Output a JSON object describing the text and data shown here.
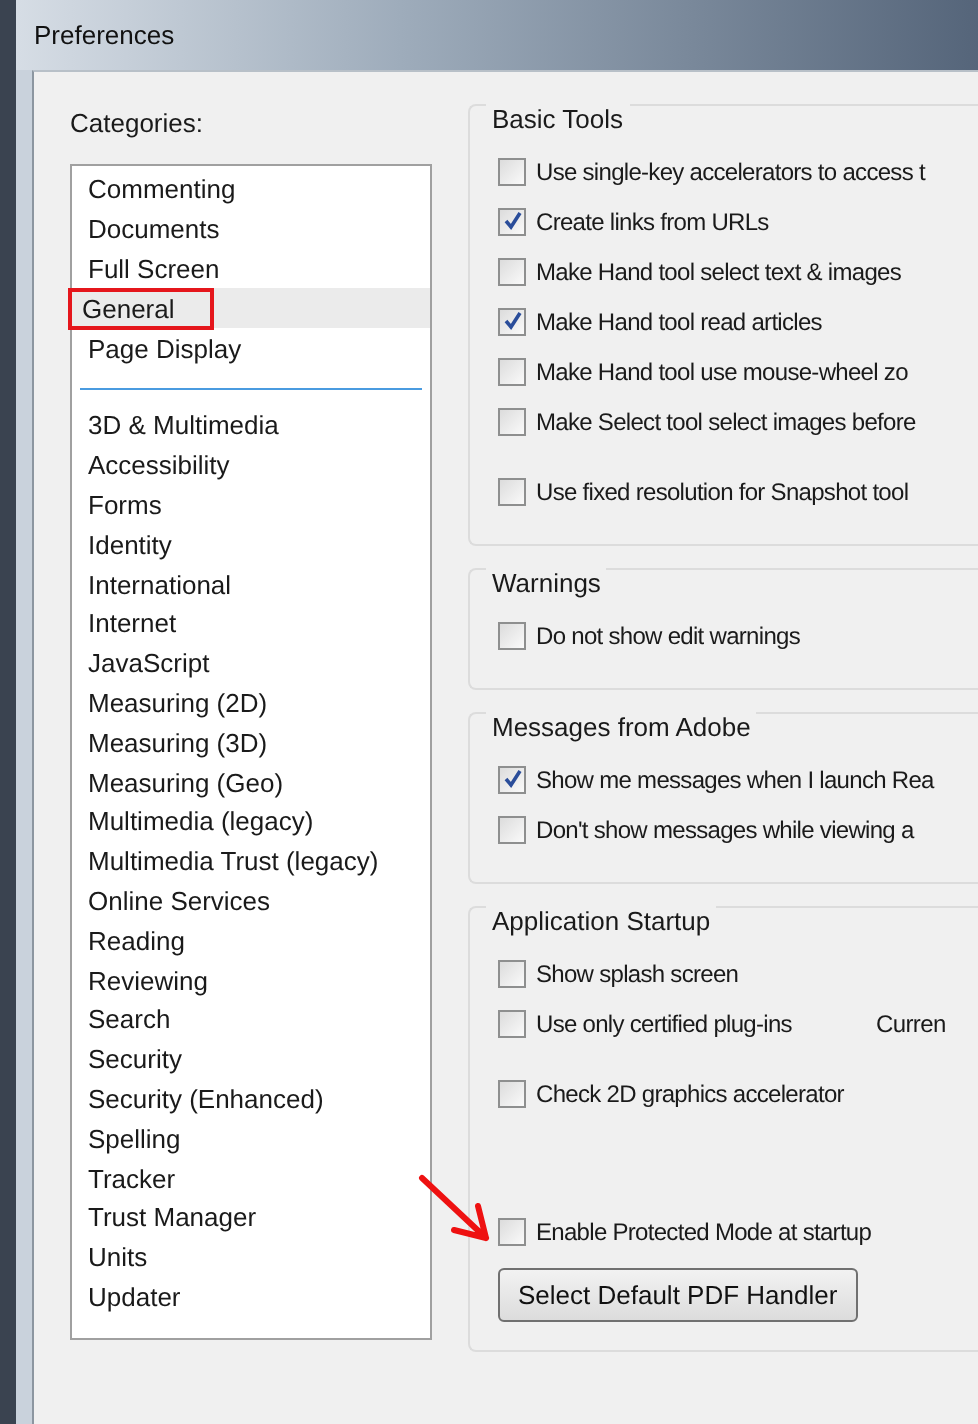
{
  "window": {
    "title": "Preferences"
  },
  "categories": {
    "label": "Categories:",
    "sections": [
      [
        {
          "label": "Commenting",
          "selected": false,
          "marked": false
        },
        {
          "label": "Documents",
          "selected": false,
          "marked": false
        },
        {
          "label": "Full Screen",
          "selected": false,
          "marked": false
        },
        {
          "label": "General",
          "selected": true,
          "marked": true
        },
        {
          "label": "Page Display",
          "selected": false,
          "marked": false
        }
      ],
      [
        {
          "label": "3D & Multimedia",
          "selected": false,
          "marked": false
        },
        {
          "label": "Accessibility",
          "selected": false,
          "marked": false
        },
        {
          "label": "Forms",
          "selected": false,
          "marked": false
        },
        {
          "label": "Identity",
          "selected": false,
          "marked": false
        },
        {
          "label": "International",
          "selected": false,
          "marked": false
        },
        {
          "label": "Internet",
          "selected": false,
          "marked": false
        },
        {
          "label": "JavaScript",
          "selected": false,
          "marked": false
        },
        {
          "label": "Measuring (2D)",
          "selected": false,
          "marked": false
        },
        {
          "label": "Measuring (3D)",
          "selected": false,
          "marked": false
        },
        {
          "label": "Measuring (Geo)",
          "selected": false,
          "marked": false
        },
        {
          "label": "Multimedia (legacy)",
          "selected": false,
          "marked": false
        },
        {
          "label": "Multimedia Trust (legacy)",
          "selected": false,
          "marked": false
        },
        {
          "label": "Online Services",
          "selected": false,
          "marked": false
        },
        {
          "label": "Reading",
          "selected": false,
          "marked": false
        },
        {
          "label": "Reviewing",
          "selected": false,
          "marked": false
        },
        {
          "label": "Search",
          "selected": false,
          "marked": false
        },
        {
          "label": "Security",
          "selected": false,
          "marked": false
        },
        {
          "label": "Security (Enhanced)",
          "selected": false,
          "marked": false
        },
        {
          "label": "Spelling",
          "selected": false,
          "marked": false
        },
        {
          "label": "Tracker",
          "selected": false,
          "marked": false
        },
        {
          "label": "Trust Manager",
          "selected": false,
          "marked": false
        },
        {
          "label": "Units",
          "selected": false,
          "marked": false
        },
        {
          "label": "Updater",
          "selected": false,
          "marked": false
        }
      ]
    ]
  },
  "groups": [
    {
      "title": "Basic Tools",
      "blocks": [
        [
          {
            "label": "Use single-key accelerators to access t",
            "checked": false,
            "marked": false
          },
          {
            "label": "Create links from URLs",
            "checked": true,
            "marked": false
          },
          {
            "label": "Make Hand tool select text & images",
            "checked": false,
            "marked": false
          },
          {
            "label": "Make Hand tool read articles",
            "checked": true,
            "marked": false
          },
          {
            "label": "Make Hand tool use mouse-wheel zo",
            "checked": false,
            "marked": false
          },
          {
            "label": "Make Select tool select images before",
            "checked": false,
            "marked": false
          }
        ],
        [
          {
            "label": "Use fixed resolution for Snapshot tool",
            "checked": false,
            "marked": false
          }
        ]
      ]
    },
    {
      "title": "Warnings",
      "blocks": [
        [
          {
            "label": "Do not show edit warnings",
            "checked": false,
            "marked": false
          }
        ]
      ]
    },
    {
      "title": "Messages from Adobe",
      "blocks": [
        [
          {
            "label": "Show me messages when I launch Rea",
            "checked": true,
            "marked": false
          },
          {
            "label": "Don't show messages while viewing a",
            "checked": false,
            "marked": false
          }
        ]
      ]
    },
    {
      "title": "Application Startup",
      "blocks": [
        [
          {
            "label": "Show splash screen",
            "checked": false,
            "marked": false
          },
          {
            "label": "Use only certified plug-ins",
            "checked": false,
            "marked": false,
            "aside": "Curren"
          }
        ],
        [
          {
            "label": "Check 2D graphics accelerator",
            "checked": false,
            "marked": false
          }
        ],
        [
          {
            "label": "Enable Protected Mode at startup",
            "checked": false,
            "marked": true
          }
        ]
      ],
      "button": "Select Default PDF Handler"
    }
  ]
}
